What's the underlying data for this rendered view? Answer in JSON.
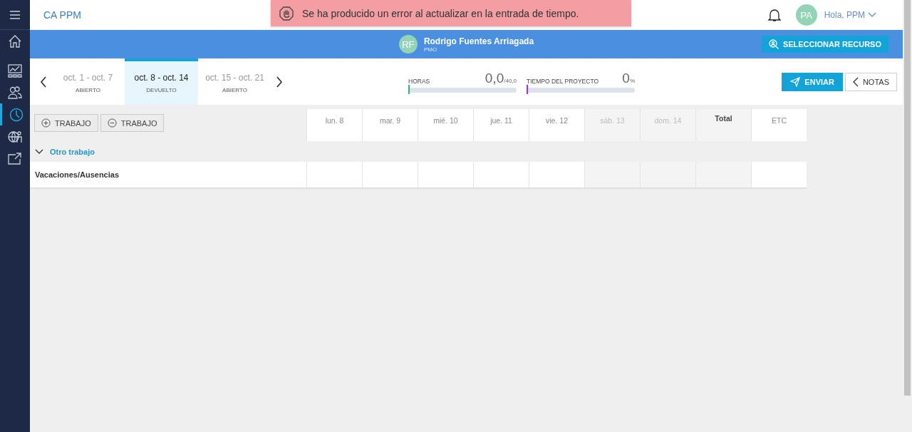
{
  "app": {
    "title": "CA PPM"
  },
  "sidebar": {
    "items": [
      {
        "kind": "home",
        "selected": false
      },
      {
        "kind": "chart",
        "selected": false
      },
      {
        "kind": "people",
        "selected": false
      },
      {
        "kind": "clock",
        "selected": true
      },
      {
        "kind": "globe",
        "selected": false
      },
      {
        "kind": "export",
        "selected": false
      }
    ]
  },
  "toast": {
    "message": "Se ha producido un error al actualizar en la entrada de tiempo."
  },
  "user": {
    "initials": "PA",
    "greeting": "Hola, PPM"
  },
  "resource": {
    "initials": "RF",
    "name": "Rodrigo Fuentes Arriagada",
    "role": "PMO",
    "button": "SELECCIONAR RECURSO"
  },
  "weeks": [
    {
      "label": "oct. 1 - oct. 7",
      "status": "ABIERTO",
      "selected": false
    },
    {
      "label": "oct. 8 - oct. 14",
      "status": "DEVUELTO",
      "selected": true
    },
    {
      "label": "oct. 15 - oct. 21",
      "status": "ABIERTO",
      "selected": false
    }
  ],
  "meters": [
    {
      "label": "HORAS",
      "value": "0,0",
      "unit": "/40,0",
      "level": 0,
      "color": "#2bb673"
    },
    {
      "label": "TIEMPO DEL PROYECTO",
      "value": "0",
      "unit": "%",
      "level": 0,
      "color": "#9b30ff"
    }
  ],
  "actions": {
    "submit": "ENVIAR",
    "notes": "NOTAS"
  },
  "toolbar": {
    "add": "TRABAJO",
    "remove": "TRABAJO"
  },
  "table": {
    "columns": [
      {
        "label": "lun. 8",
        "kind": "day"
      },
      {
        "label": "mar. 9",
        "kind": "day"
      },
      {
        "label": "mié. 10",
        "kind": "day"
      },
      {
        "label": "jue. 11",
        "kind": "day"
      },
      {
        "label": "vie. 12",
        "kind": "day"
      },
      {
        "label": "sáb. 13",
        "kind": "weekend"
      },
      {
        "label": "dom. 14",
        "kind": "weekend"
      },
      {
        "label": "Total",
        "kind": "total"
      },
      {
        "label": "ETC",
        "kind": "etc"
      }
    ],
    "groups": [
      {
        "name": "Otro trabajo",
        "expanded": true,
        "rows": [
          {
            "name": "Vacaciones/Ausencias"
          }
        ]
      }
    ]
  }
}
